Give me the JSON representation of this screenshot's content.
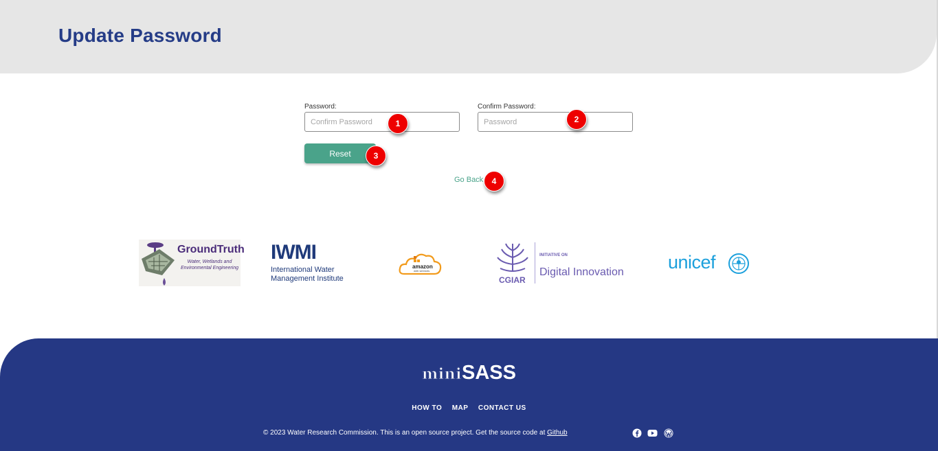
{
  "header": {
    "title": "Update Password"
  },
  "form": {
    "password_label": "Password:",
    "password_placeholder": "Confirm Password",
    "confirm_label": "Confirm Password:",
    "confirm_placeholder": "Password",
    "reset_label": "Reset",
    "go_back_label": "Go Back"
  },
  "annotations": [
    "1",
    "2",
    "3",
    "4"
  ],
  "logos": {
    "groundtruth_name": "GroundTruth",
    "groundtruth_sub": "Water, Wetlands and Environmental Engineering",
    "iwmi_mark": "IWMI",
    "iwmi_line1": "International Water",
    "iwmi_line2": "Management Institute",
    "aws_text": "amazon",
    "aws_sub": "web services",
    "cgiar_label": "CGIAR",
    "cgiar_initiative": "INITIATIVE ON",
    "cgiar_digital": "Digital Innovation",
    "unicef_text": "unicef"
  },
  "footer": {
    "brand_mini": "mini",
    "brand_sass": "SASS",
    "nav": [
      "HOW TO",
      "MAP",
      "CONTACT US"
    ],
    "copyright": "© 2023 Water Research Commission. This is an open source project. Get the source code at ",
    "github_label": "Github",
    "social_icons": [
      "facebook-icon",
      "youtube-icon",
      "wordpress-icon"
    ]
  },
  "colors": {
    "header_bg": "#e6e6e6",
    "title": "#253c87",
    "accent_green": "#4aa38a",
    "footer_bg": "#253884",
    "badge_red": "#ee0000"
  }
}
